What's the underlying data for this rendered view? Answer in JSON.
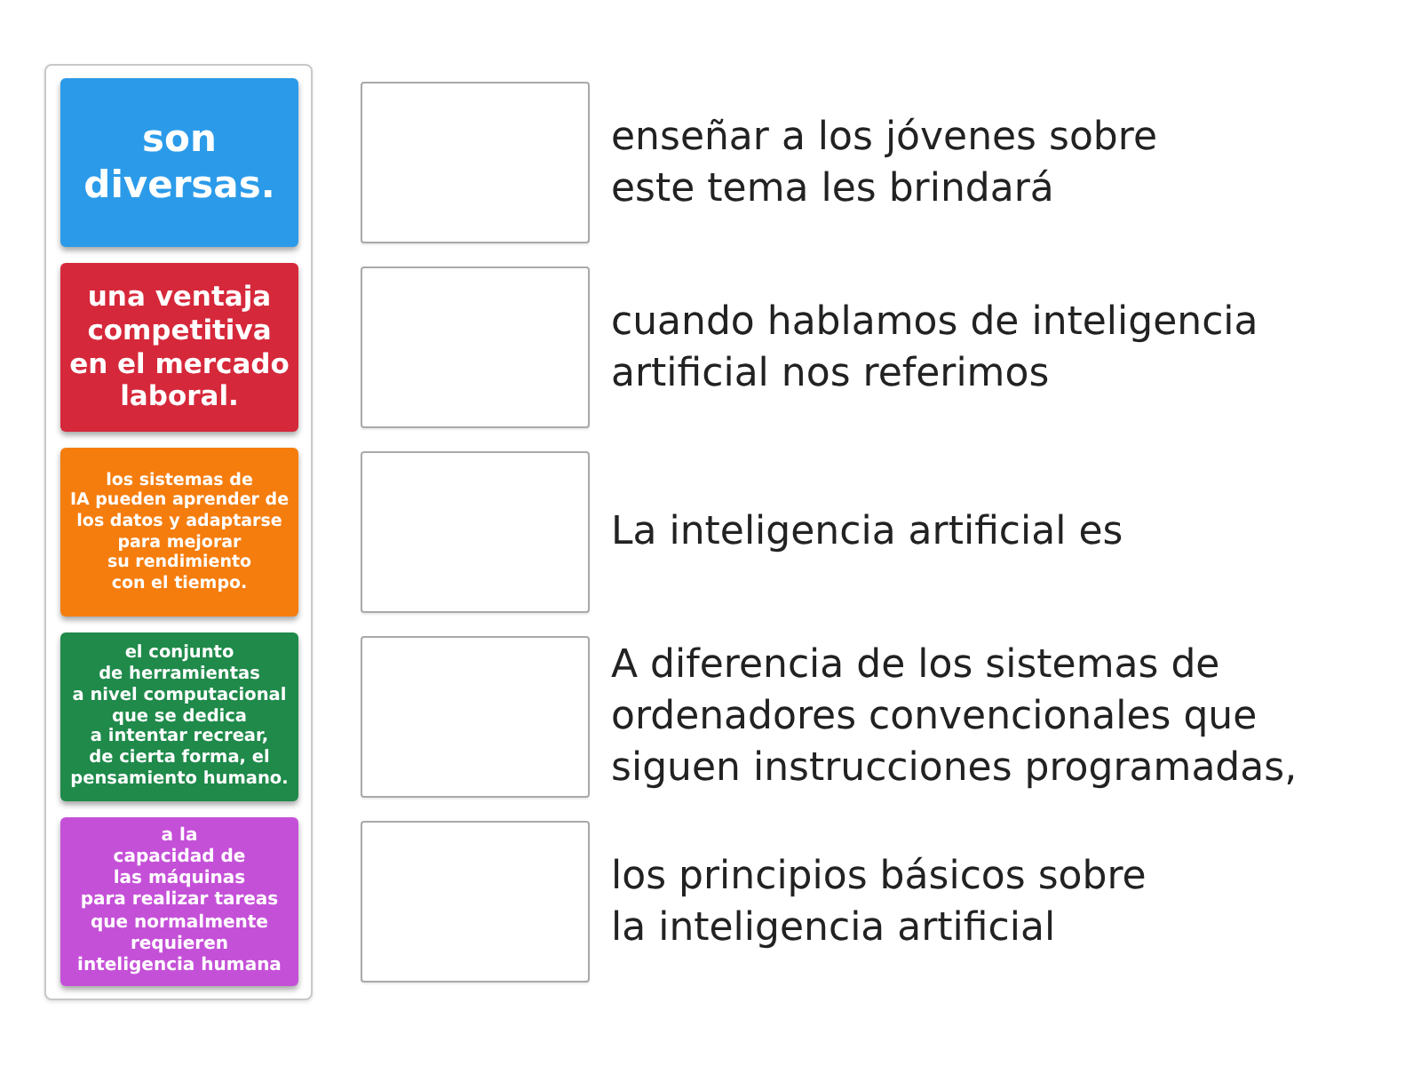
{
  "tiles": [
    {
      "text": "son\ndiversas.",
      "color": "#2b9be9"
    },
    {
      "text": "una ventaja\ncompetitiva\nen el mercado\nlaboral.",
      "color": "#d6283b"
    },
    {
      "text": "los sistemas de\nIA pueden aprender de\nlos datos y adaptarse\npara mejorar\nsu rendimiento\ncon el tiempo.",
      "color": "#f57d0e"
    },
    {
      "text": "el conjunto\nde herramientas\na nivel computacional\nque se dedica\na intentar recrear,\nde cierta forma, el\npensamiento humano.",
      "color": "#1f8a4a"
    },
    {
      "text": "a la\ncapacidad de\nlas máquinas\npara realizar tareas\nque normalmente\nrequieren\ninteligencia humana",
      "color": "#c550d8"
    }
  ],
  "targets": [
    {
      "prompt": "enseñar a los jóvenes sobre\neste tema les brindará"
    },
    {
      "prompt": "cuando hablamos de inteligencia\nartificial nos referimos"
    },
    {
      "prompt": "La inteligencia artificial es"
    },
    {
      "prompt": "A diferencia de los sistemas de\nordenadores convencionales que\nsiguen instrucciones programadas,"
    },
    {
      "prompt": "los principios básicos sobre\nla inteligencia artificial"
    }
  ]
}
